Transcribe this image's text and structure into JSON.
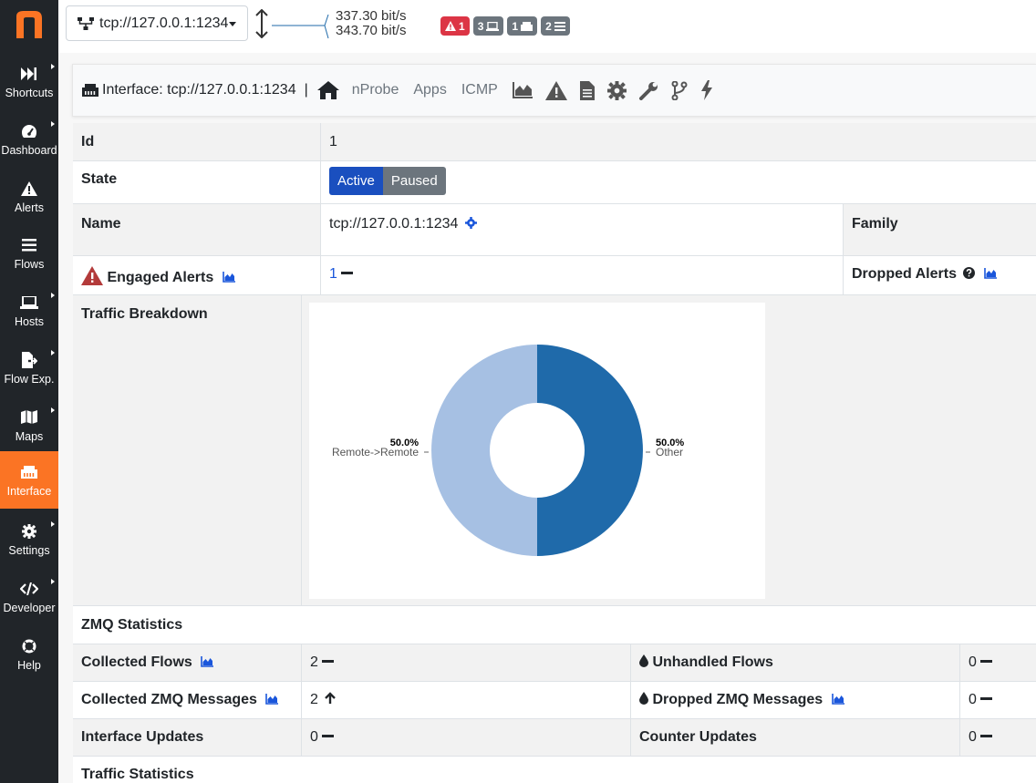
{
  "sidebar": {
    "items": [
      {
        "label": "Shortcuts",
        "icon": "fast-forward-icon",
        "has_submenu": true,
        "active": false
      },
      {
        "label": "Dashboard",
        "icon": "gauge-icon",
        "has_submenu": true,
        "active": false
      },
      {
        "label": "Alerts",
        "icon": "warning-icon",
        "has_submenu": false,
        "active": false
      },
      {
        "label": "Flows",
        "icon": "bars-icon",
        "has_submenu": false,
        "active": false
      },
      {
        "label": "Hosts",
        "icon": "laptop-icon",
        "has_submenu": true,
        "active": false
      },
      {
        "label": "Flow Exp.",
        "icon": "file-export-icon",
        "has_submenu": true,
        "active": false
      },
      {
        "label": "Maps",
        "icon": "map-icon",
        "has_submenu": true,
        "active": false
      },
      {
        "label": "Interface",
        "icon": "ethernet-icon",
        "has_submenu": false,
        "active": true
      },
      {
        "label": "Settings",
        "icon": "gear-icon",
        "has_submenu": true,
        "active": false
      },
      {
        "label": "Developer",
        "icon": "code-icon",
        "has_submenu": true,
        "active": false
      },
      {
        "label": "Help",
        "icon": "life-ring-icon",
        "has_submenu": false,
        "active": false
      }
    ]
  },
  "topbar": {
    "interface_selected": "tcp://127.0.0.1:1234",
    "throughput_up": "337.30 bit/s",
    "throughput_down": "343.70 bit/s",
    "badges": {
      "alerts": "1",
      "hosts": "3",
      "devices": "1",
      "flows": "2"
    }
  },
  "subnav": {
    "title": "Interface: tcp://127.0.0.1:1234",
    "separator": "|",
    "links": [
      "nProbe",
      "Apps",
      "ICMP"
    ]
  },
  "table": {
    "id_label": "Id",
    "id_value": "1",
    "state_label": "State",
    "state_active": "Active",
    "state_paused": "Paused",
    "name_label": "Name",
    "name_value": "tcp://127.0.0.1:1234",
    "family_label": "Family",
    "engaged_alerts_label": "Engaged Alerts",
    "engaged_alerts_value": "1",
    "dropped_alerts_label": "Dropped Alerts",
    "traffic_breakdown_label": "Traffic Breakdown",
    "zmq_statistics_label": "ZMQ Statistics",
    "collected_flows_label": "Collected Flows",
    "collected_flows_value": "2",
    "unhandled_flows_label": "Unhandled Flows",
    "unhandled_flows_value": "0",
    "collected_zmq_label": "Collected ZMQ Messages",
    "collected_zmq_value": "2",
    "dropped_zmq_label": "Dropped ZMQ Messages",
    "dropped_zmq_value": "0",
    "interface_updates_label": "Interface Updates",
    "interface_updates_value": "0",
    "counter_updates_label": "Counter Updates",
    "counter_updates_value": "0",
    "traffic_statistics_label": "Traffic Statistics"
  },
  "colors": {
    "sidebar_bg": "#212529",
    "accent_orange": "#fb7424",
    "slice_other": "#1f6aaa",
    "slice_remote": "#a6c0e3",
    "active_button": "#1a4fbf"
  },
  "chart_data": {
    "type": "pie",
    "donut": true,
    "slices": [
      {
        "label": "Other",
        "value": 50.0,
        "pct_label": "50.0%"
      },
      {
        "label": "Remote->Remote",
        "value": 50.0,
        "pct_label": "50.0%"
      }
    ]
  }
}
